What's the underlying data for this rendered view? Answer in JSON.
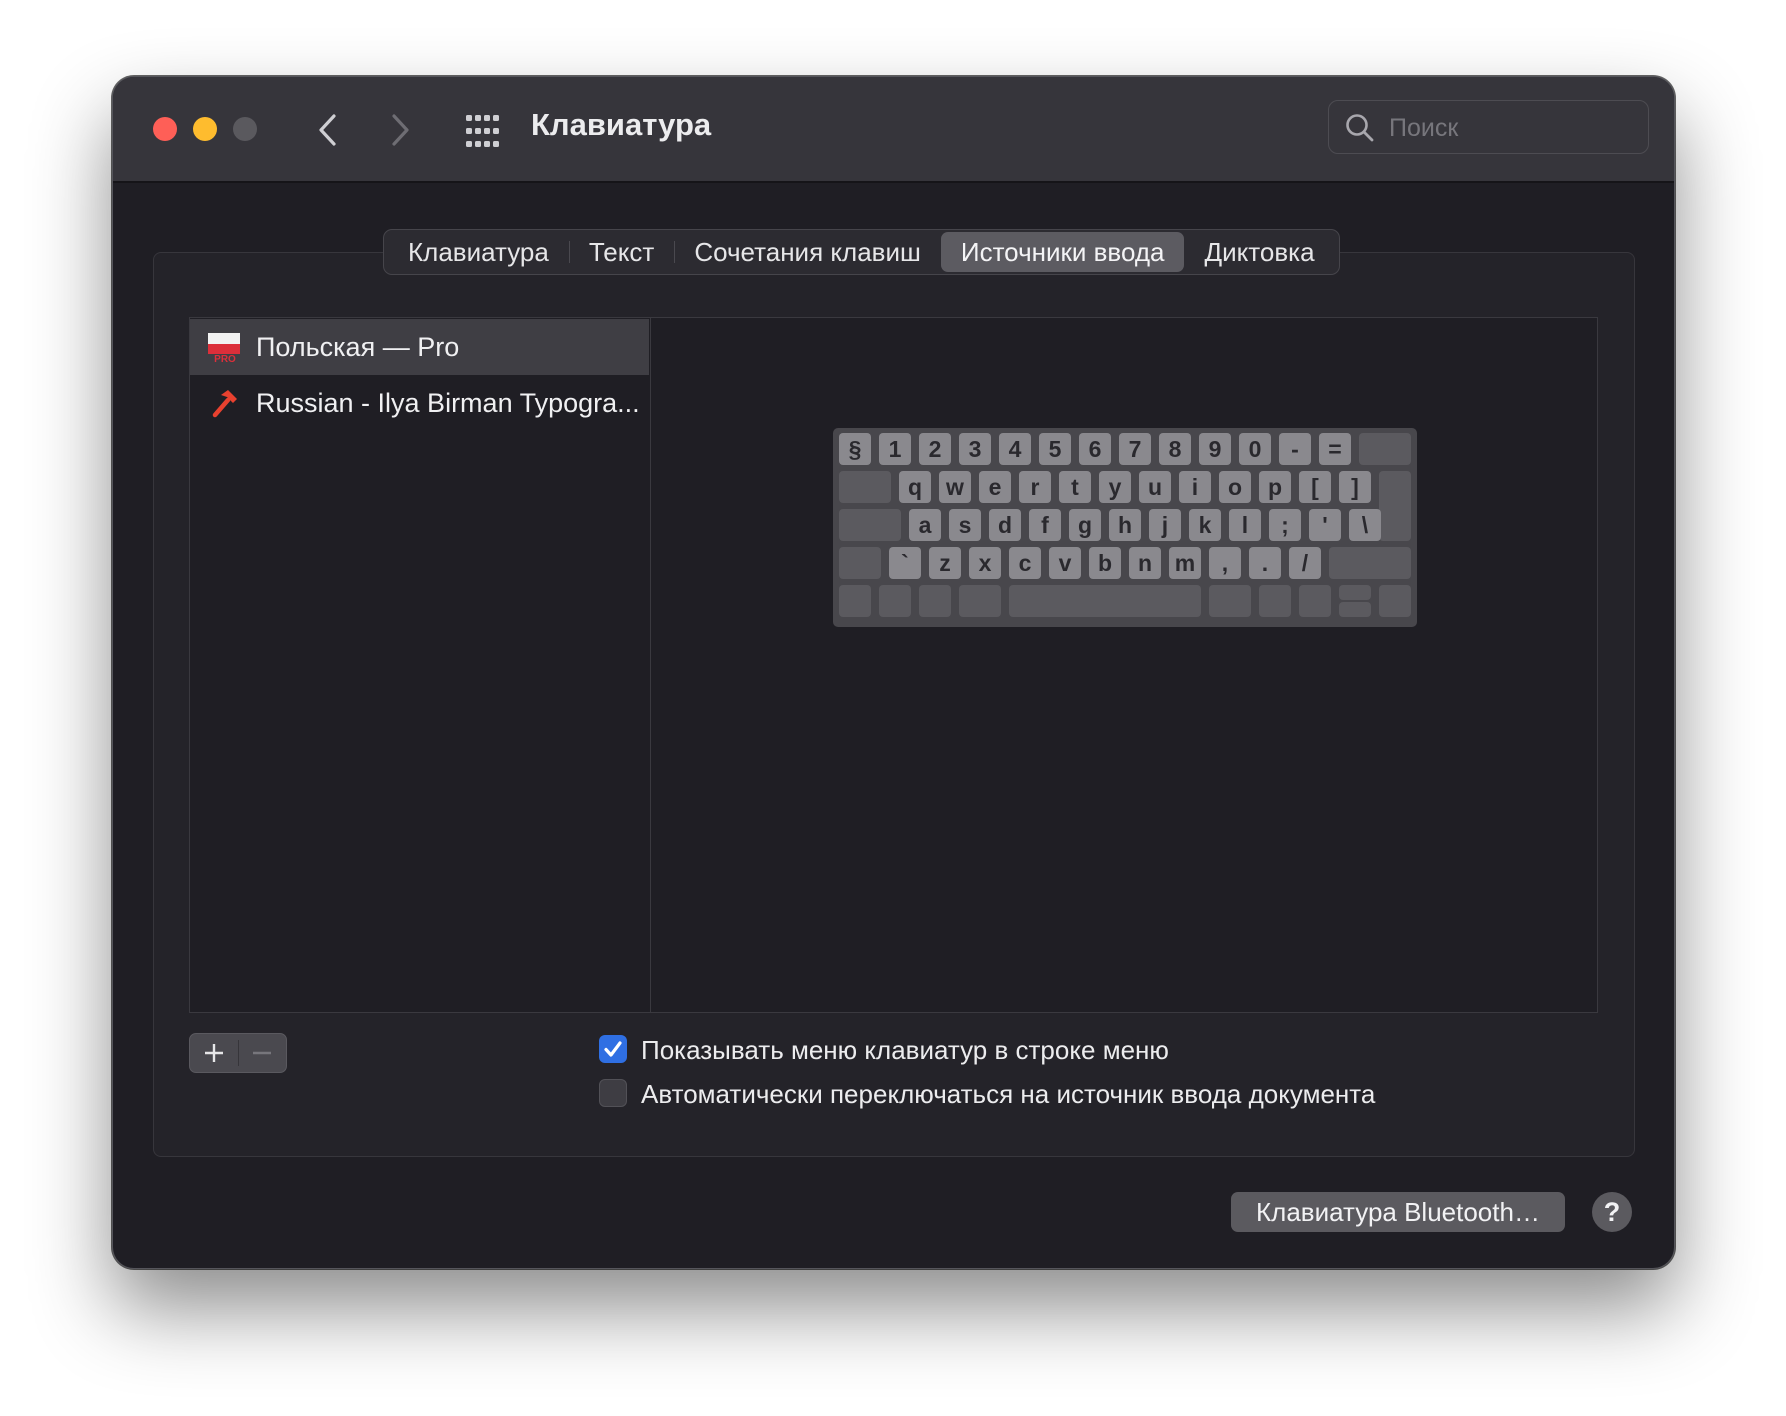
{
  "window": {
    "title": "Клавиатура"
  },
  "search": {
    "placeholder": "Поиск"
  },
  "tabs": [
    {
      "label": "Клавиатура"
    },
    {
      "label": "Текст"
    },
    {
      "label": "Сочетания клавиш"
    },
    {
      "label": "Источники ввода",
      "active": true
    },
    {
      "label": "Диктовка"
    }
  ],
  "input_sources": [
    {
      "label": "Польская — Pro",
      "icon": "polish-flag-icon",
      "flag_badge": "PRO",
      "selected": true
    },
    {
      "label": "Russian - Ilya Birman Typogra...",
      "icon": "hammer-icon",
      "selected": false
    }
  ],
  "keyboard_rows": [
    [
      "§",
      "1",
      "2",
      "3",
      "4",
      "5",
      "6",
      "7",
      "8",
      "9",
      "0",
      "-",
      "="
    ],
    [
      "q",
      "w",
      "e",
      "r",
      "t",
      "y",
      "u",
      "i",
      "o",
      "p",
      "[",
      "]"
    ],
    [
      "a",
      "s",
      "d",
      "f",
      "g",
      "h",
      "j",
      "k",
      "l",
      ";",
      "'",
      "\\"
    ],
    [
      "`",
      "z",
      "x",
      "c",
      "v",
      "b",
      "n",
      "m",
      ",",
      ".",
      "/"
    ]
  ],
  "options": {
    "show_menu": {
      "label": "Показывать меню клавиатур в строке меню",
      "checked": true
    },
    "auto_switch": {
      "label": "Автоматически переключаться на источник ввода документа",
      "checked": false
    }
  },
  "buttons": {
    "add": "+",
    "remove": "—",
    "bluetooth": "Клавиатура Bluetooth…",
    "help": "?"
  },
  "colors": {
    "accent": "#2f6fe3",
    "close": "#fe5f57",
    "minimize": "#febc2e",
    "window_bg": "#1f1e24"
  }
}
